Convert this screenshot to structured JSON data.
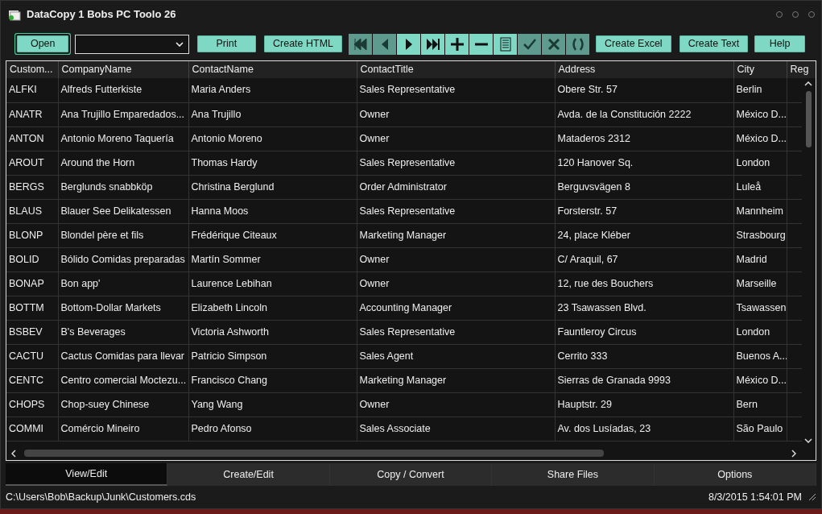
{
  "window": {
    "title": "DataCopy 1 Bobs PC Toolo 26"
  },
  "toolbar": {
    "open": "Open",
    "print": "Print",
    "create_html": "Create HTML",
    "nav_buttons": [
      {
        "kind": "first",
        "disabled": true
      },
      {
        "kind": "prev",
        "disabled": true
      },
      {
        "kind": "next",
        "disabled": false
      },
      {
        "kind": "last",
        "disabled": false
      },
      {
        "kind": "add",
        "disabled": false
      },
      {
        "kind": "remove",
        "disabled": false
      },
      {
        "kind": "edit",
        "disabled": false
      },
      {
        "kind": "confirm",
        "disabled": true
      },
      {
        "kind": "cancel",
        "disabled": true
      },
      {
        "kind": "refresh",
        "disabled": true
      }
    ],
    "create_excel": "Create Excel",
    "create_text": "Create Text",
    "help": "Help"
  },
  "table": {
    "columns": [
      "Custom...",
      "CompanyName",
      "ContactName",
      "ContactTitle",
      "Address",
      "City",
      "Reg"
    ],
    "rows": [
      [
        "ALFKI",
        "Alfreds Futterkiste",
        "Maria Anders",
        "Sales Representative",
        "Obere Str. 57",
        "Berlin"
      ],
      [
        "ANATR",
        "Ana Trujillo Emparedados...",
        "Ana Trujillo",
        "Owner",
        "Avda. de la Constitución 2222",
        "México D..."
      ],
      [
        "ANTON",
        "Antonio Moreno Taquería",
        "Antonio Moreno",
        "Owner",
        "Mataderos  2312",
        "México D..."
      ],
      [
        "AROUT",
        "Around the Horn",
        "Thomas Hardy",
        "Sales Representative",
        "120 Hanover Sq.",
        "London"
      ],
      [
        "BERGS",
        "Berglunds snabbköp",
        "Christina Berglund",
        "Order Administrator",
        "Berguvsvägen  8",
        "Luleå"
      ],
      [
        "BLAUS",
        "Blauer See Delikatessen",
        "Hanna Moos",
        "Sales Representative",
        "Forsterstr. 57",
        "Mannheim"
      ],
      [
        "BLONP",
        "Blondel père et fils",
        "Frédérique Citeaux",
        "Marketing Manager",
        "24, place Kléber",
        "Strasbourg"
      ],
      [
        "BOLID",
        "Bólido Comidas preparadas",
        "Martín Sommer",
        "Owner",
        "C/ Araquil, 67",
        "Madrid"
      ],
      [
        "BONAP",
        "Bon app'",
        "Laurence Lebihan",
        "Owner",
        "12, rue des Bouchers",
        "Marseille"
      ],
      [
        "BOTTM",
        "Bottom-Dollar Markets",
        "Elizabeth Lincoln",
        "Accounting Manager",
        "23 Tsawassen Blvd.",
        "Tsawassen"
      ],
      [
        "BSBEV",
        "B's Beverages",
        "Victoria Ashworth",
        "Sales Representative",
        "Fauntleroy Circus",
        "London"
      ],
      [
        "CACTU",
        "Cactus Comidas para llevar",
        "Patricio Simpson",
        "Sales Agent",
        "Cerrito 333",
        "Buenos A..."
      ],
      [
        "CENTC",
        "Centro comercial Moctezu...",
        "Francisco Chang",
        "Marketing Manager",
        "Sierras de Granada 9993",
        "México D..."
      ],
      [
        "CHOPS",
        "Chop-suey Chinese",
        "Yang Wang",
        "Owner",
        "Hauptstr. 29",
        "Bern"
      ],
      [
        "COMMI",
        "Comércio Mineiro",
        "Pedro Afonso",
        "Sales Associate",
        "Av. dos Lusíadas, 23",
        "São Paulo"
      ]
    ]
  },
  "bottom_tabs": [
    {
      "label": "View/Edit",
      "selected": true
    },
    {
      "label": "Create/Edit",
      "selected": false
    },
    {
      "label": "Copy / Convert",
      "selected": false
    },
    {
      "label": "Share Files",
      "selected": false
    },
    {
      "label": "Options",
      "selected": false
    }
  ],
  "status_bar": {
    "path": "C:\\Users\\Bob\\Backup\\Junk\\Customers.cds",
    "datetime": "8/3/2015 1:54:01 PM"
  }
}
